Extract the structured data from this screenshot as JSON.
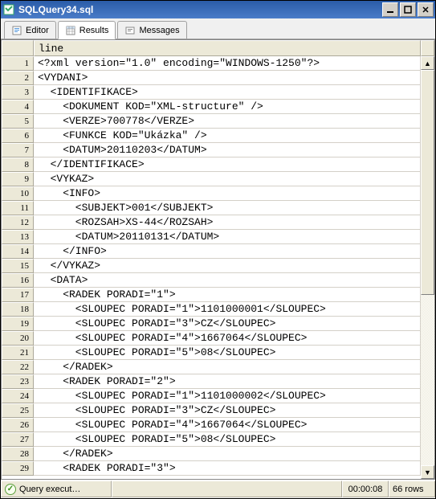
{
  "window": {
    "title": "SQLQuery34.sql"
  },
  "tabs": {
    "editor": "Editor",
    "results": "Results",
    "messages": "Messages"
  },
  "grid": {
    "column_header": "line",
    "rows": [
      "<?xml version=\"1.0\" encoding=\"WINDOWS-1250\"?>",
      "<VYDANI>",
      "  <IDENTIFIKACE>",
      "    <DOKUMENT KOD=\"XML-structure\" />",
      "    <VERZE>700778</VERZE>",
      "    <FUNKCE KOD=\"Ukázka\" />",
      "    <DATUM>20110203</DATUM>",
      "  </IDENTIFIKACE>",
      "  <VYKAZ>",
      "    <INFO>",
      "      <SUBJEKT>001</SUBJEKT>",
      "      <ROZSAH>XS-44</ROZSAH>",
      "      <DATUM>20110131</DATUM>",
      "    </INFO>",
      "  </VYKAZ>",
      "  <DATA>",
      "    <RADEK PORADI=\"1\">",
      "      <SLOUPEC PORADI=\"1\">1101000001</SLOUPEC>",
      "      <SLOUPEC PORADI=\"3\">CZ</SLOUPEC>",
      "      <SLOUPEC PORADI=\"4\">1667064</SLOUPEC>",
      "      <SLOUPEC PORADI=\"5\">08</SLOUPEC>",
      "    </RADEK>",
      "    <RADEK PORADI=\"2\">",
      "      <SLOUPEC PORADI=\"1\">1101000002</SLOUPEC>",
      "      <SLOUPEC PORADI=\"3\">CZ</SLOUPEC>",
      "      <SLOUPEC PORADI=\"4\">1667064</SLOUPEC>",
      "      <SLOUPEC PORADI=\"5\">08</SLOUPEC>",
      "    </RADEK>",
      "    <RADEK PORADI=\"3\">"
    ]
  },
  "status": {
    "message": "Query execut…",
    "time": "00:00:08",
    "rows": "66 rows"
  }
}
